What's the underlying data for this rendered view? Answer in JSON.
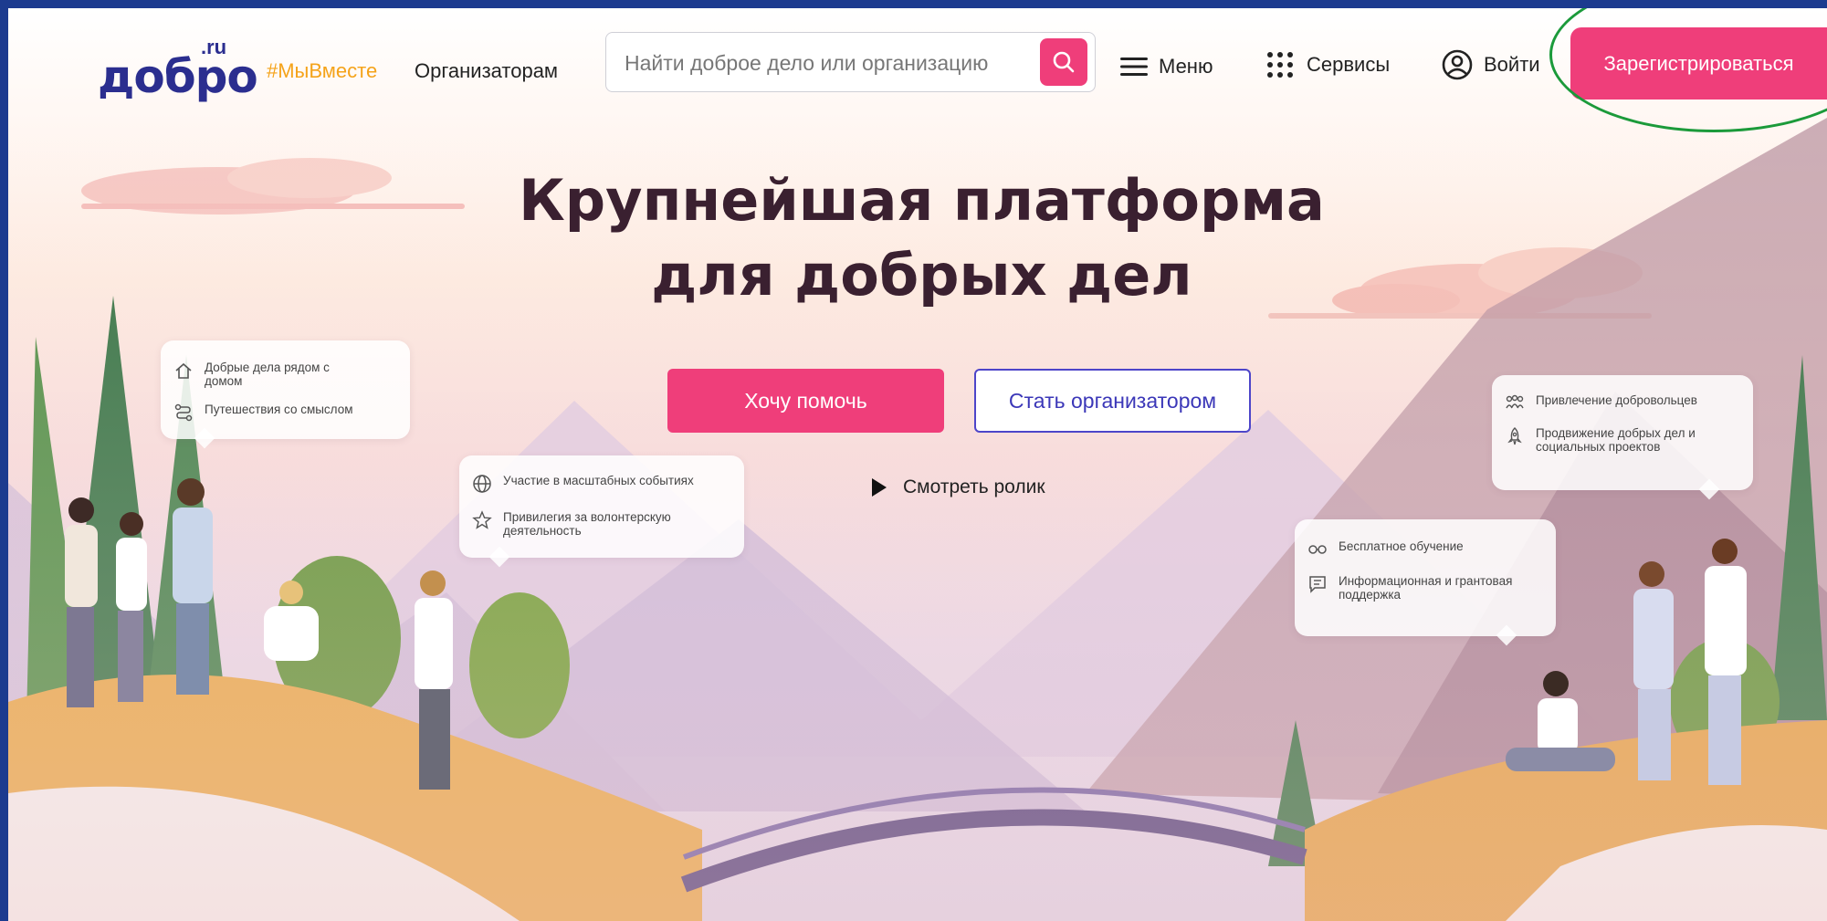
{
  "header": {
    "logo_main": "добро",
    "logo_ru": ".ru",
    "tag": "#МыВместе",
    "organizers": "Организаторам",
    "search_placeholder": "Найти доброе дело или организацию",
    "menu": "Меню",
    "services": "Сервисы",
    "login": "Войти",
    "register": "Зарегистрироваться"
  },
  "hero": {
    "title_line1": "Крупнейшая платформа",
    "title_line2": "для добрых дел",
    "help_button": "Хочу помочь",
    "organizer_button": "Стать организатором",
    "video_link": "Смотреть ролик"
  },
  "bubbles": {
    "b1": {
      "item1": "Добрые дела рядом с домом",
      "item2": "Путешествия со смыслом"
    },
    "b2": {
      "item1": "Участие в масштабных событиях",
      "item2": "Привилегия за волонтерскую деятельность"
    },
    "b3": {
      "item1": "Бесплатное обучение",
      "item2": "Информационная и грантовая поддержка"
    },
    "b4": {
      "item1": "Привлечение добровольцев",
      "item2": "Продвижение добрых дел и социальных проектов"
    }
  },
  "colors": {
    "accent": "#ef3e7a",
    "brand": "#2b2e8f",
    "tag": "#f5a31a",
    "outline_button": "#4d45c9",
    "annotation_ring": "#1b9a3a",
    "frame": "#1c3b8f"
  }
}
